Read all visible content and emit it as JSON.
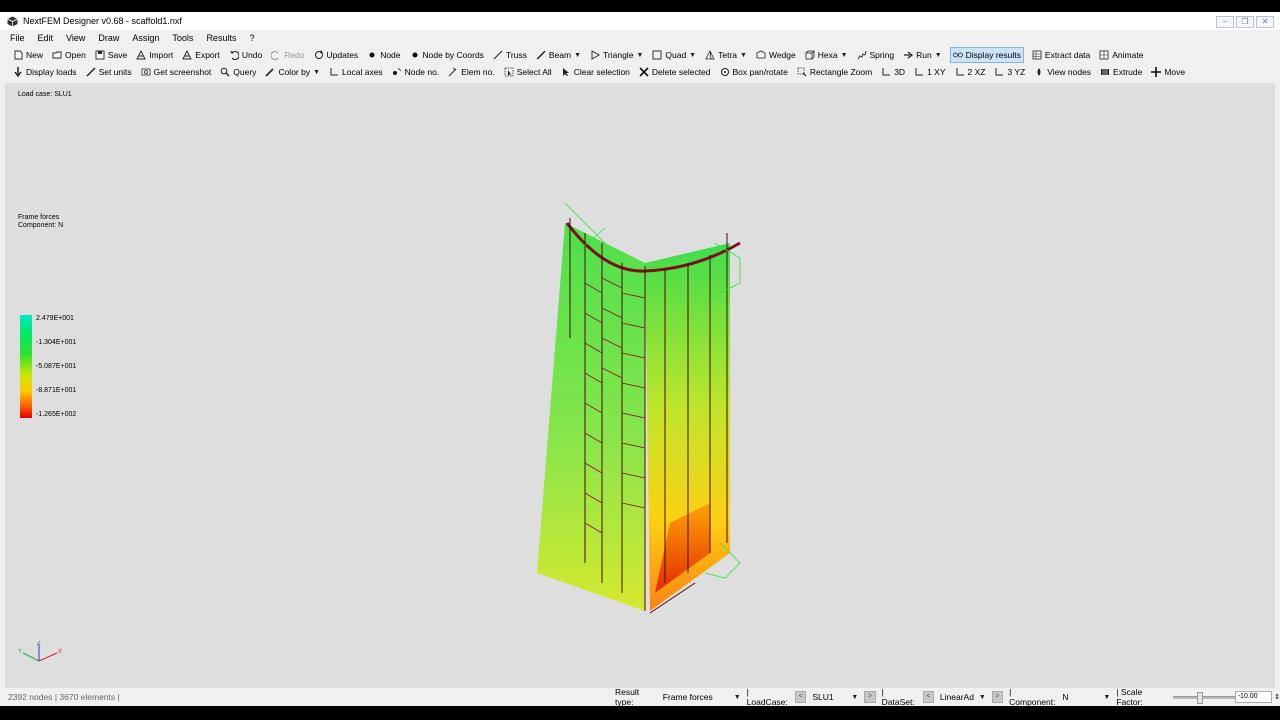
{
  "window": {
    "title": "NextFEM Designer v0.68 - scaffold1.nxf",
    "controls": [
      "minimize",
      "restore",
      "close"
    ]
  },
  "menu": [
    "File",
    "Edit",
    "View",
    "Draw",
    "Assign",
    "Tools",
    "Results",
    "?"
  ],
  "toolbar1": [
    {
      "label": "New",
      "icon": "new-file-icon"
    },
    {
      "label": "Open",
      "icon": "folder-icon"
    },
    {
      "label": "Save",
      "icon": "save-icon"
    },
    {
      "label": "Import",
      "icon": "import-icon"
    },
    {
      "label": "Export",
      "icon": "export-icon"
    },
    {
      "label": "Undo",
      "icon": "undo-icon"
    },
    {
      "label": "Redo",
      "icon": "redo-icon",
      "disabled": true
    },
    {
      "label": "Updates",
      "icon": "refresh-icon"
    },
    {
      "label": "Node",
      "icon": "node-icon"
    },
    {
      "label": "Node by Coords",
      "icon": "node-icon"
    },
    {
      "label": "Truss",
      "icon": "truss-icon"
    },
    {
      "label": "Beam",
      "icon": "beam-icon",
      "dropdown": true
    },
    {
      "label": "Triangle",
      "icon": "triangle-icon",
      "dropdown": true
    },
    {
      "label": "Quad",
      "icon": "quad-icon",
      "dropdown": true
    },
    {
      "label": "Tetra",
      "icon": "tetra-icon",
      "dropdown": true
    },
    {
      "label": "Wedge",
      "icon": "wedge-icon"
    },
    {
      "label": "Hexa",
      "icon": "hexa-icon",
      "dropdown": true
    },
    {
      "label": "Spring",
      "icon": "spring-icon"
    },
    {
      "label": "Run",
      "icon": "run-icon",
      "dropdown": true
    },
    {
      "label": "Display results",
      "icon": "glasses-icon",
      "active": true
    },
    {
      "label": "Extract data",
      "icon": "table-icon"
    },
    {
      "label": "Animate",
      "icon": "animate-icon"
    }
  ],
  "toolbar2": [
    {
      "label": "Display loads",
      "icon": "load-arrow-icon"
    },
    {
      "label": "Set units",
      "icon": "ruler-icon"
    },
    {
      "label": "Get screenshot",
      "icon": "camera-icon"
    },
    {
      "label": "Query",
      "icon": "magnifier-icon"
    },
    {
      "label": "Color by",
      "icon": "pencil-icon",
      "dropdown": true
    },
    {
      "label": "Local axes",
      "icon": "axes-icon"
    },
    {
      "label": "Node no.",
      "icon": "node-number-icon"
    },
    {
      "label": "Elem no.",
      "icon": "elem-number-icon"
    },
    {
      "label": "Select All",
      "icon": "select-all-icon"
    },
    {
      "label": "Clear selection",
      "icon": "cursor-icon"
    },
    {
      "label": "Delete selected",
      "icon": "delete-x-icon"
    },
    {
      "label": "Box pan/rotate",
      "icon": "rotate-icon"
    },
    {
      "label": "Rectangle Zoom",
      "icon": "zoom-rect-icon"
    },
    {
      "label": "3D",
      "icon": "view-3d-icon"
    },
    {
      "label": "1 XY",
      "icon": "view-xy-icon"
    },
    {
      "label": "2 XZ",
      "icon": "view-xz-icon"
    },
    {
      "label": "3 YZ",
      "icon": "view-yz-icon"
    },
    {
      "label": "View nodes",
      "icon": "view-nodes-icon"
    },
    {
      "label": "Extrude",
      "icon": "extrude-icon"
    },
    {
      "label": "Move",
      "icon": "move-cross-icon"
    }
  ],
  "viewport": {
    "load_case": "Load case: SLU1",
    "result_title_line1": "Frame forces",
    "result_title_line2": "Component: N",
    "legend": {
      "values": [
        "2.479E+001",
        "-1.304E+001",
        "-5.087E+001",
        "-8.871E+001",
        "-1.265E+002"
      ],
      "colors": [
        "#00e8c8",
        "#00e868",
        "#c8e800",
        "#ffc800",
        "#e00000"
      ]
    },
    "triad": {
      "x": "X",
      "y": "Y",
      "z": "Z"
    }
  },
  "status": {
    "nodes": "2392 nodes",
    "elements": "3670 elements",
    "result_type_label": "Result type:",
    "result_type_value": "Frame forces",
    "loadcase_label": "| LoadCase:",
    "loadcase_value": "SLU1",
    "dataset_label": "| DataSet:",
    "dataset_value": "LinearAd",
    "component_label": "| Component:",
    "component_value": "N",
    "scale_label": "| Scale Factor:",
    "scale_value": "-10.00"
  }
}
